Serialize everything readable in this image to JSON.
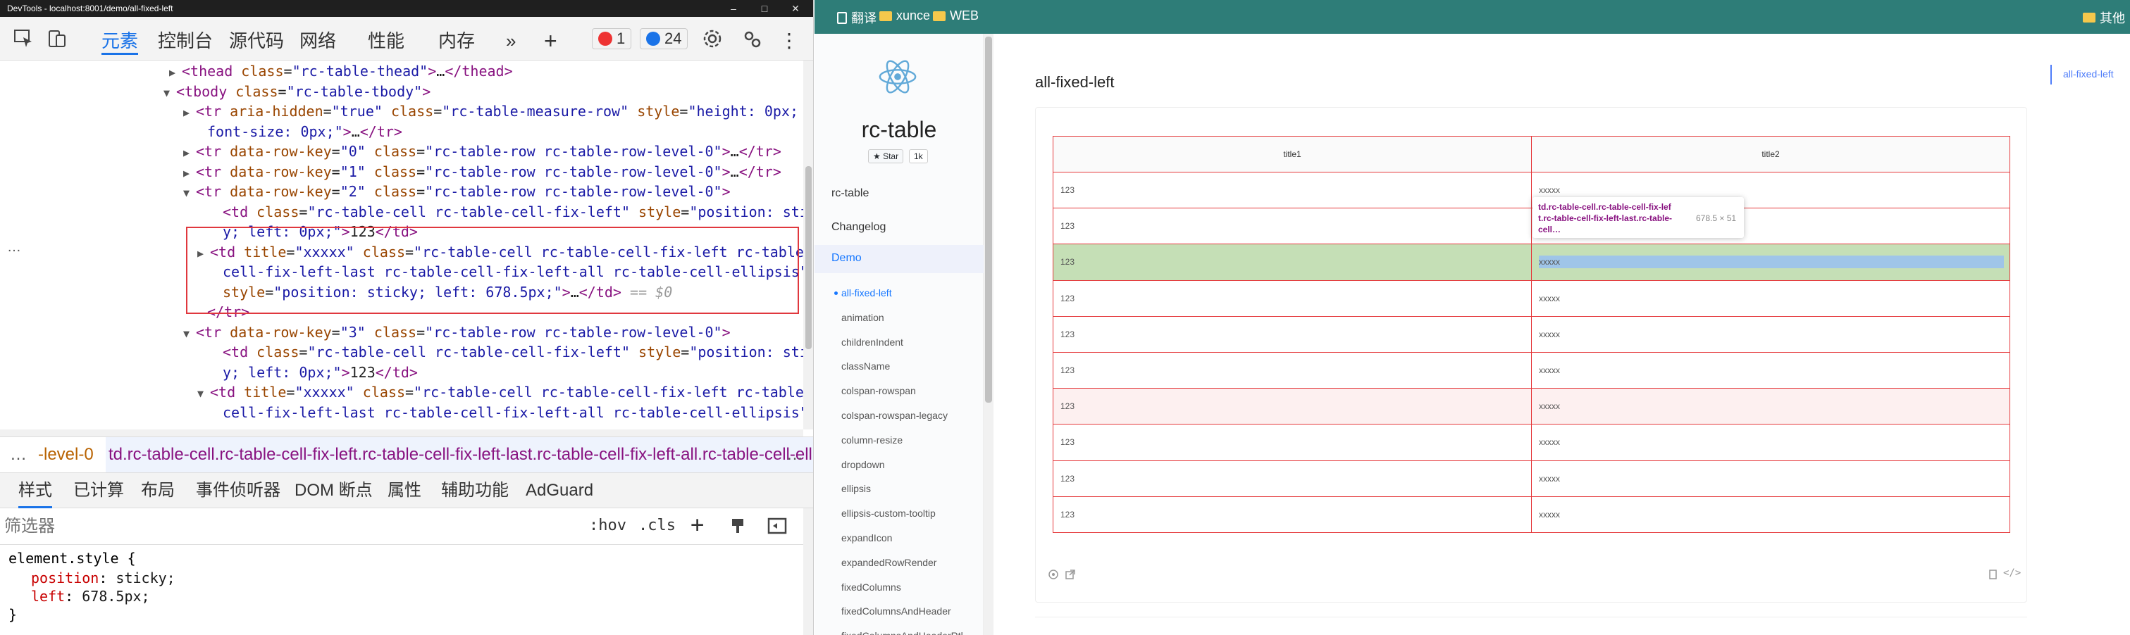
{
  "window": {
    "title": "DevTools - localhost:8001/demo/all-fixed-left",
    "minimize": "–",
    "maximize": "□",
    "close": "✕"
  },
  "devtools": {
    "tabs": [
      {
        "label": "元素",
        "active": true
      },
      {
        "label": "控制台"
      },
      {
        "label": "源代码"
      },
      {
        "label": "网络"
      },
      {
        "label": "性能"
      },
      {
        "label": "内存"
      }
    ],
    "more_tabs": "»",
    "add_tab": "+",
    "error_count": "1",
    "message_count": "24",
    "more_menu": "⋮",
    "dom_lines": [
      {
        "indent": 258,
        "tri": "▶",
        "html": "<span class=tg>&lt;thead</span> <span class=at>class</span>=<span class=av>\"rc-table-thead\"</span><span class=tg>&gt;</span>…<span class=tg>&lt;/thead&gt;</span>"
      },
      {
        "indent": 250,
        "tri": "▼",
        "html": "<span class=tg>&lt;tbody</span> <span class=at>class</span>=<span class=av>\"rc-table-tbody\"</span><span class=tg>&gt;</span>"
      },
      {
        "indent": 278,
        "tri": "▶",
        "html": "<span class=tg>&lt;tr</span> <span class=at>aria-hidden</span>=<span class=av>\"true\"</span> <span class=at>class</span>=<span class=av>\"rc-table-measure-row\"</span> <span class=at>style</span>=<span class=av>\"height: 0px;</span>"
      },
      {
        "indent": 294,
        "tri": "",
        "html": "<span class=av>font-size: 0px;\"</span><span class=tg>&gt;</span>…<span class=tg>&lt;/tr&gt;</span>"
      },
      {
        "indent": 278,
        "tri": "▶",
        "html": "<span class=tg>&lt;tr</span> <span class=at>data-row-key</span>=<span class=av>\"0\"</span> <span class=at>class</span>=<span class=av>\"rc-table-row rc-table-row-level-0\"</span><span class=tg>&gt;</span>…<span class=tg>&lt;/tr&gt;</span>"
      },
      {
        "indent": 278,
        "tri": "▶",
        "html": "<span class=tg>&lt;tr</span> <span class=at>data-row-key</span>=<span class=av>\"1\"</span> <span class=at>class</span>=<span class=av>\"rc-table-row rc-table-row-level-0\"</span><span class=tg>&gt;</span>…<span class=tg>&lt;/tr&gt;</span>"
      },
      {
        "indent": 278,
        "tri": "▼",
        "html": "<span class=tg>&lt;tr</span> <span class=at>data-row-key</span>=<span class=av>\"2\"</span> <span class=at>class</span>=<span class=av>\"rc-table-row rc-table-row-level-0\"</span><span class=tg>&gt;</span>"
      },
      {
        "indent": 316,
        "tri": "",
        "html": "<span class=tg>&lt;td</span> <span class=at>class</span>=<span class=av>\"rc-table-cell rc-table-cell-fix-left\"</span> <span class=at>style</span>=<span class=av>\"position: stick</span>"
      },
      {
        "indent": 316,
        "tri": "",
        "html": "<span class=av>y; left: 0px;\"</span><span class=tg>&gt;</span><span class=tx>123</span><span class=tg>&lt;/td&gt;</span>"
      },
      {
        "indent": 298,
        "tri": "▶",
        "html": "<span class=tg>&lt;td</span> <span class=at>title</span>=<span class=av>\"xxxxx\"</span> <span class=at>class</span>=<span class=av>\"rc-table-cell rc-table-cell-fix-left rc-table-</span>"
      },
      {
        "indent": 316,
        "tri": "",
        "html": "<span class=av>cell-fix-left-last rc-table-cell-fix-left-all rc-table-cell-ellipsis\"</span>"
      },
      {
        "indent": 316,
        "tri": "",
        "html": "<span class=at>style</span>=<span class=av>\"position: sticky; left: 678.5px;\"</span><span class=tg>&gt;</span>…<span class=tg>&lt;/td&gt;</span> <span class=cm>== $0</span>"
      },
      {
        "indent": 294,
        "tri": "",
        "html": "<span class=tg>&lt;/tr&gt;</span>"
      },
      {
        "indent": 278,
        "tri": "▼",
        "html": "<span class=tg>&lt;tr</span> <span class=at>data-row-key</span>=<span class=av>\"3\"</span> <span class=at>class</span>=<span class=av>\"rc-table-row rc-table-row-level-0\"</span><span class=tg>&gt;</span>"
      },
      {
        "indent": 316,
        "tri": "",
        "html": "<span class=tg>&lt;td</span> <span class=at>class</span>=<span class=av>\"rc-table-cell rc-table-cell-fix-left\"</span> <span class=at>style</span>=<span class=av>\"position: stick</span>"
      },
      {
        "indent": 316,
        "tri": "",
        "html": "<span class=av>y; left: 0px;\"</span><span class=tg>&gt;</span><span class=tx>123</span><span class=tg>&lt;/td&gt;</span>"
      },
      {
        "indent": 298,
        "tri": "▼",
        "html": "<span class=tg>&lt;td</span> <span class=at>title</span>=<span class=av>\"xxxxx\"</span> <span class=at>class</span>=<span class=av>\"rc-table-cell rc-table-cell-fix-left rc-table-</span>"
      },
      {
        "indent": 316,
        "tri": "",
        "html": "<span class=av>cell-fix-left-last rc-table-cell-fix-left-all rc-table-cell-ellipsis\"</span>"
      }
    ],
    "row_dots": "…",
    "breadcrumb_dots": "…",
    "breadcrumb_left": "-level-0",
    "breadcrumb_right": "td.rc-table-cell.rc-table-cell-fix-left.rc-table-cell-fix-left-last.rc-table-cell-fix-left-all.rc-table-cell-ellipsis",
    "breadcrumb_more": "…",
    "styles_tabs": [
      "样式",
      "已计算",
      "布局",
      "事件侦听器",
      "DOM 断点",
      "属性",
      "辅助功能",
      "AdGuard"
    ],
    "filter_placeholder": "筛选器",
    "hov": ":hov",
    "cls": ".cls",
    "add_rule": "+",
    "element_style": {
      "selector": "element.style {",
      "props": [
        {
          "name": "position",
          "value": "sticky;"
        },
        {
          "name": "left",
          "value": "678.5px;"
        }
      ],
      "close": "}"
    }
  },
  "browser": {
    "bookmarks": [
      {
        "label": "翻译",
        "icon": "page-icon"
      },
      {
        "label": "xunce",
        "icon": "folder-icon"
      },
      {
        "label": "WEB",
        "icon": "folder-icon"
      }
    ],
    "bookmarks_other": "其他",
    "site": {
      "title": "rc-table",
      "star_label": "Star",
      "star_count": "1k",
      "nav_top": [
        "rc-table",
        "Changelog",
        "Demo"
      ],
      "nav_sub": [
        "all-fixed-left",
        "animation",
        "childrenIndent",
        "className",
        "colspan-rowspan",
        "colspan-rowspan-legacy",
        "column-resize",
        "dropdown",
        "ellipsis",
        "ellipsis-custom-tooltip",
        "expandIcon",
        "expandedRowRender",
        "fixedColumns",
        "fixedColumnsAndHeader",
        "fixedColumnsAndHeaderRtl"
      ],
      "page_heading": "all-fixed-left",
      "toc": "all-fixed-left"
    },
    "table": {
      "headers": [
        "title1",
        "title2"
      ],
      "rows": [
        [
          "123",
          "xxxxx"
        ],
        [
          "123",
          "xxxxx"
        ],
        [
          "123",
          "xxxxx"
        ],
        [
          "123",
          "xxxxx"
        ],
        [
          "123",
          "xxxxx"
        ],
        [
          "123",
          "xxxxx"
        ],
        [
          "123",
          "xxxxx"
        ],
        [
          "123",
          "xxxxx"
        ],
        [
          "123",
          "xxxxx"
        ],
        [
          "123",
          "xxxxx"
        ]
      ]
    },
    "tooltip": {
      "selector_line1": "td.rc-table-cell.rc-table-cell-fix-lef",
      "selector_line2": "t.rc-table-cell-fix-left-last.rc-table-",
      "selector_line3": "cell…",
      "size": "678.5 × 51"
    },
    "colors": {
      "bookmark_bar": "#2e7d78",
      "table_border": "#e5383b",
      "accent": "#1677ff"
    }
  }
}
